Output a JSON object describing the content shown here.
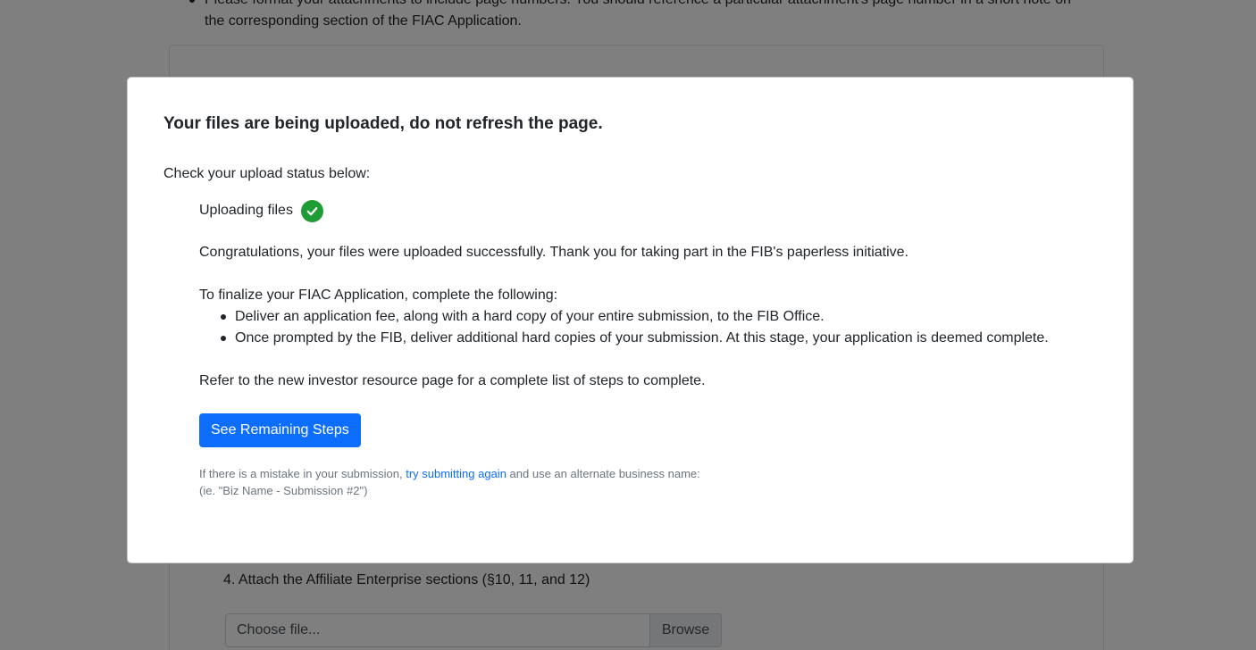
{
  "background": {
    "bullet_text": "Please format your attachments to include page numbers. You should reference a particular attachment's page number in a short note on the corresponding section of the FIAC Application.",
    "step4_label": "4. Attach the Affiliate Enterprise sections (§10, 11, and 12)",
    "file_input": {
      "placeholder": "Choose file...",
      "browse_label": "Browse"
    }
  },
  "modal": {
    "title": "Your files are being uploaded, do not refresh the page.",
    "status_intro": "Check your upload status below:",
    "upload_status": {
      "label": "Uploading files",
      "icon": "check-circle-icon",
      "color": "#1f9d35"
    },
    "congrats": "Congratulations, your files were uploaded successfully. Thank you for taking part in the FIB's paperless initiative.",
    "finalize_intro": "To finalize your FIAC Application, complete the following:",
    "steps": [
      "Deliver an application fee, along with a hard copy of your entire submission, to the FIB Office.",
      "Once prompted by the FIB, deliver additional hard copies of your submission. At this stage, your application is deemed complete."
    ],
    "refer": "Refer to the new investor resource page for a complete list of steps to complete.",
    "button_label": "See Remaining Steps",
    "note": {
      "prefix": "If there is a mistake in your submission, ",
      "link": "try submitting again",
      "suffix": " and use an alternate business name:",
      "example": "(ie. \"Biz Name - Submission #2\")"
    }
  },
  "colors": {
    "primary": "#0d6efd",
    "success": "#1f9d35",
    "backdrop": "rgba(0,0,0,0.5)"
  }
}
